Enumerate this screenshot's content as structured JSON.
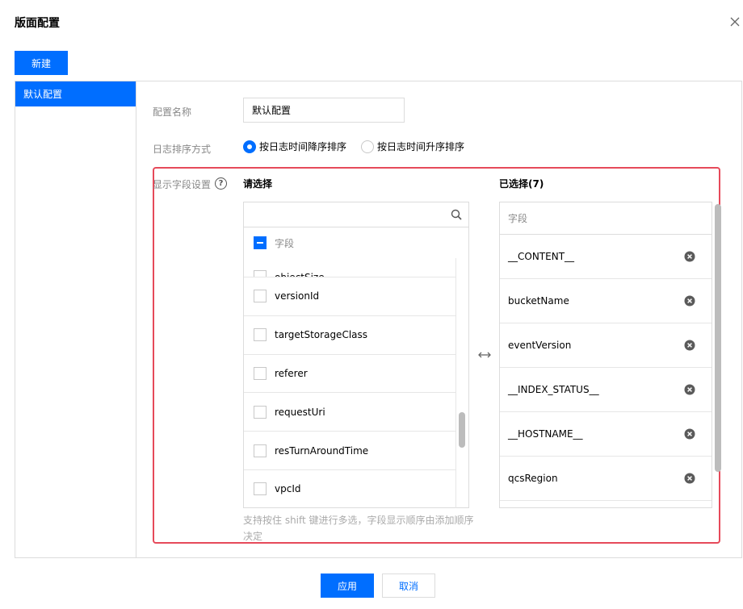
{
  "dialog": {
    "title": "版面配置"
  },
  "toolbar": {
    "new_label": "新建"
  },
  "configs": [
    {
      "label": "默认配置",
      "active": true
    }
  ],
  "form": {
    "name_label": "配置名称",
    "name_value": "默认配置",
    "sort_label": "日志排序方式",
    "sort_options": [
      {
        "label": "按日志时间降序排序",
        "checked": true
      },
      {
        "label": "按日志时间升序排序",
        "checked": false
      }
    ],
    "fields_label": "显示字段设置",
    "help_icon": "?"
  },
  "source": {
    "title": "请选择",
    "search_placeholder": "",
    "header_label": "字段",
    "items": [
      {
        "label": "objectSize"
      },
      {
        "label": "versionId"
      },
      {
        "label": "targetStorageClass"
      },
      {
        "label": "referer"
      },
      {
        "label": "requestUri"
      },
      {
        "label": "resTurnAroundTime"
      },
      {
        "label": "vpcId"
      }
    ],
    "hint": "支持按住 shift 键进行多选，字段显示顺序由添加顺序决定"
  },
  "selected": {
    "title": "已选择(7)",
    "header_label": "字段",
    "items": [
      {
        "label": "__CONTENT__"
      },
      {
        "label": "bucketName"
      },
      {
        "label": "eventVersion"
      },
      {
        "label": "__INDEX_STATUS__"
      },
      {
        "label": "__HOSTNAME__"
      },
      {
        "label": "qcsRegion"
      }
    ]
  },
  "footer": {
    "apply_label": "应用",
    "cancel_label": "取消"
  },
  "colors": {
    "accent": "#006eff",
    "highlight": "#e64a5a"
  }
}
